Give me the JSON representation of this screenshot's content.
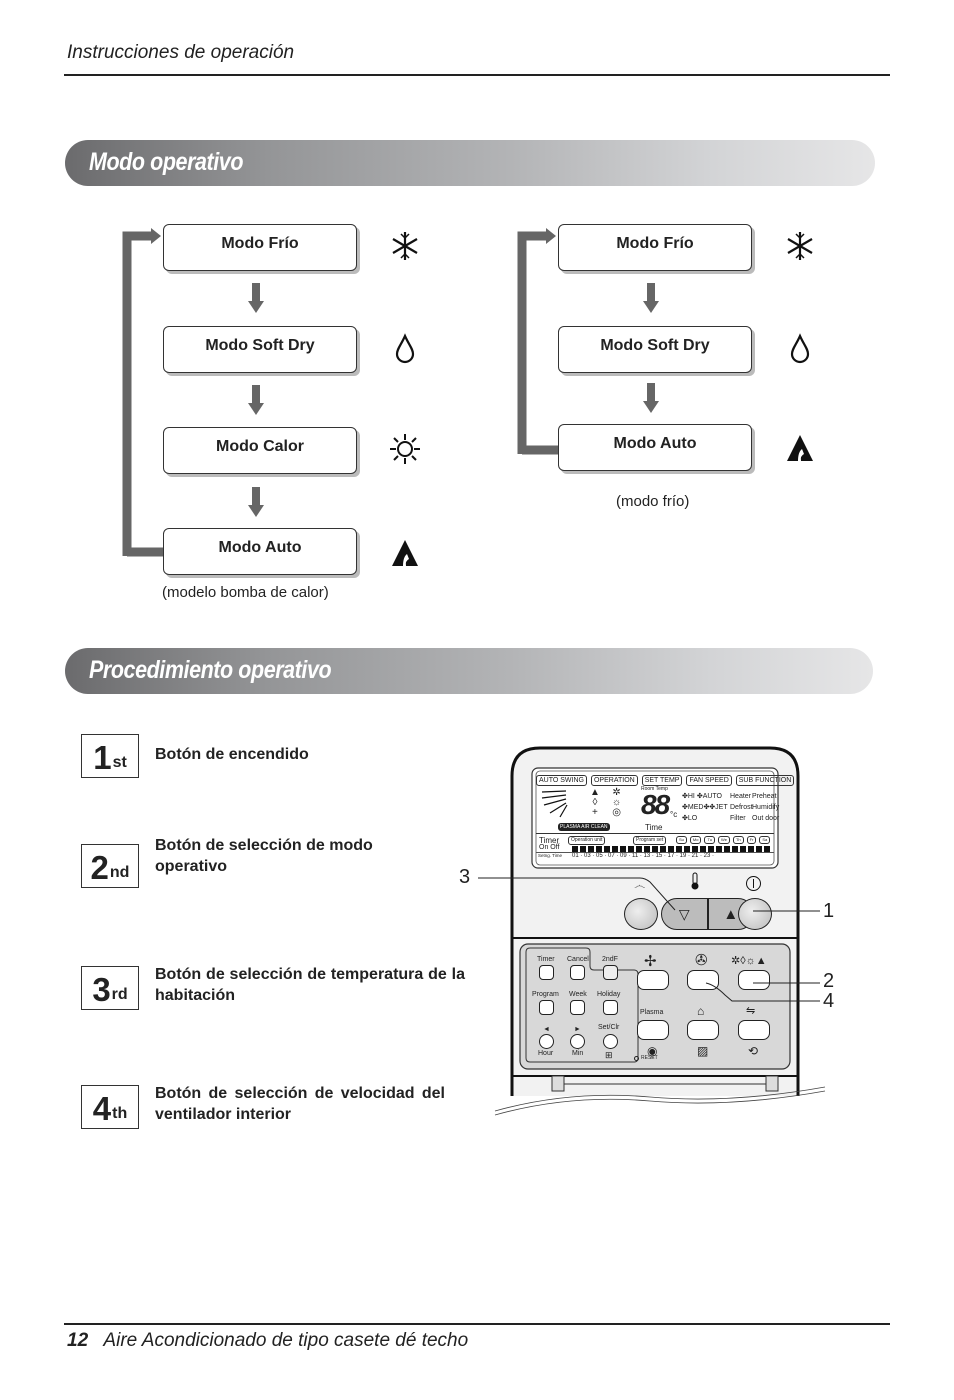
{
  "header": {
    "section_title": "Instrucciones de operación"
  },
  "banners": {
    "modes": "Modo operativo",
    "procedure": "Procedimiento operativo"
  },
  "heat_pump_cycle": {
    "caption": "(modelo bomba de calor)",
    "modes": [
      {
        "label": "Modo Frío",
        "icon": "snowflake-icon"
      },
      {
        "label": "Modo Soft Dry",
        "icon": "droplet-icon"
      },
      {
        "label": "Modo Calor",
        "icon": "sun-icon"
      },
      {
        "label": "Modo Auto",
        "icon": "auto-icon"
      }
    ]
  },
  "cool_only_cycle": {
    "caption": "(modo frío)",
    "modes": [
      {
        "label": "Modo Frío",
        "icon": "snowflake-icon"
      },
      {
        "label": "Modo Soft Dry",
        "icon": "droplet-icon"
      },
      {
        "label": "Modo Auto",
        "icon": "auto-icon"
      }
    ]
  },
  "steps": [
    {
      "num": "1",
      "suffix": "st",
      "text": "Botón de encendido"
    },
    {
      "num": "2",
      "suffix": "nd",
      "text": "Botón de selección de modo operativo"
    },
    {
      "num": "3",
      "suffix": "rd",
      "text": "Botón de selección de temperatura de la habitación"
    },
    {
      "num": "4",
      "suffix": "th",
      "text": "Botón de selección de velocidad del ventilador interior"
    }
  ],
  "remote": {
    "callouts": {
      "c1": "1",
      "c2": "2",
      "c3": "3",
      "c4": "4"
    },
    "lcd": {
      "labels": [
        "AUTO SWING",
        "OPERATION",
        "SET TEMP",
        "FAN SPEED",
        "SUB FUNCTION"
      ],
      "room_temp": "Room Temp",
      "digits": "88",
      "unit": "°c",
      "time": "Time",
      "fan": {
        "hi": "HI",
        "med": "MED",
        "lo": "LO",
        "auto": "AUTO",
        "jet": "JET"
      },
      "sub": [
        "Heater",
        "Preheat",
        "Defrost",
        "Humidify",
        "Filter",
        "Out door"
      ],
      "plasma": "PLASMA AIR CLEAN",
      "timer": "Timer",
      "on_off": "On  Off",
      "operation_unit": "Operation unit",
      "program_set": "Program set",
      "days": [
        "Su",
        "Mo",
        "Tu",
        "We",
        "Th",
        "Fr",
        "Sa"
      ],
      "setting_time": "Setng.  Time",
      "hours": "01 · 03 · 05 · 07 · 09 · 11 · 13 · 15 · 17 · 19 · 21 · 23 ·"
    },
    "panel": {
      "timer": "Timer",
      "cancel": "Cancel",
      "second_f": "2ndF",
      "program": "Program",
      "week": "Week",
      "holiday": "Holiday",
      "hour": "Hour",
      "min": "Min",
      "set_clr": "Set/Clr",
      "plasma": "Plasma",
      "reset": "RESET"
    }
  }
}
